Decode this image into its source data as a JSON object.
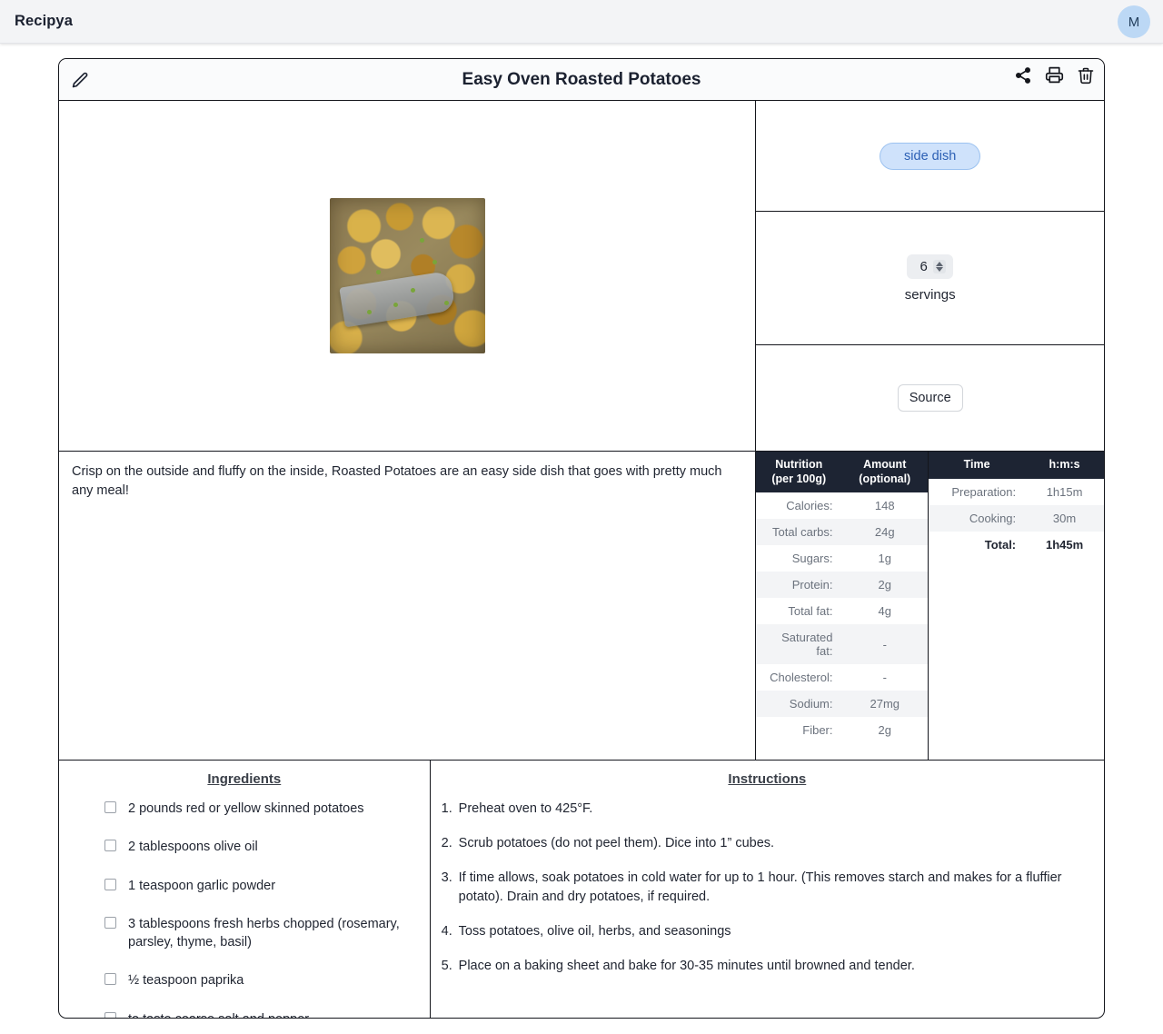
{
  "navbar": {
    "brand": "Recipya",
    "avatar_initial": "M"
  },
  "card_header": {
    "title": "Easy Oven Roasted Potatoes",
    "edit_icon": "pencil-icon",
    "actions": [
      {
        "name": "share-icon",
        "label": "Share"
      },
      {
        "name": "print-icon",
        "label": "Print"
      },
      {
        "name": "delete-icon",
        "label": "Delete"
      }
    ]
  },
  "image": {
    "alt": "Easy Oven Roasted Potatoes"
  },
  "sidebar": {
    "category": "side dish",
    "servings_value": "6",
    "servings_label": "servings",
    "source_label": "Source"
  },
  "description": "Crisp on the outside and fluffy on the inside, Roasted Potatoes are an easy side dish that goes with pretty much any meal!",
  "nutrition": {
    "header": {
      "left_line1": "Nutrition",
      "left_line2": "(per 100g)",
      "right_line1": "Amount",
      "right_line2": "(optional)"
    },
    "rows": [
      {
        "label": "Calories:",
        "value": "148"
      },
      {
        "label": "Total carbs:",
        "value": "24g"
      },
      {
        "label": "Sugars:",
        "value": "1g"
      },
      {
        "label": "Protein:",
        "value": "2g"
      },
      {
        "label": "Total fat:",
        "value": "4g"
      },
      {
        "label": "Saturated fat:",
        "value": "-"
      },
      {
        "label": "Cholesterol:",
        "value": "-"
      },
      {
        "label": "Sodium:",
        "value": "27mg"
      },
      {
        "label": "Fiber:",
        "value": "2g"
      }
    ]
  },
  "times": {
    "header": {
      "left": "Time",
      "right": "h:m:s"
    },
    "rows": [
      {
        "label": "Preparation:",
        "value": "1h15m",
        "total": false
      },
      {
        "label": "Cooking:",
        "value": "30m",
        "total": false
      },
      {
        "label": "Total:",
        "value": "1h45m",
        "total": true
      }
    ]
  },
  "ingredients": {
    "title": "Ingredients",
    "items": [
      "2 pounds red or yellow skinned potatoes",
      "2 tablespoons olive oil",
      "1 teaspoon garlic powder",
      "3 tablespoons fresh herbs chopped (rosemary, parsley, thyme, basil)",
      "½ teaspoon paprika",
      "to taste coarse salt and pepper"
    ]
  },
  "instructions": {
    "title": "Instructions",
    "items": [
      {
        "num": "1.",
        "text": "Preheat oven to 425°F."
      },
      {
        "num": "2.",
        "text": "Scrub potatoes (do not peel them). Dice into 1” cubes."
      },
      {
        "num": "3.",
        "text": "If time allows, soak potatoes in cold water for up to 1 hour. (This removes starch and makes for a fluffier potato). Drain and dry potatoes, if required."
      },
      {
        "num": "4.",
        "text": "Toss potatoes, olive oil, herbs, and seasonings"
      },
      {
        "num": "5.",
        "text": "Place on a baking sheet and bake for 30-35 minutes until browned and tender."
      }
    ]
  },
  "colors": {
    "navbar_bg": "#f3f4f6",
    "table_header_bg": "#1d2433",
    "badge_bg": "#cfe2fb",
    "badge_text": "#2b5fb4",
    "avatar_bg": "#bcd8f5"
  }
}
